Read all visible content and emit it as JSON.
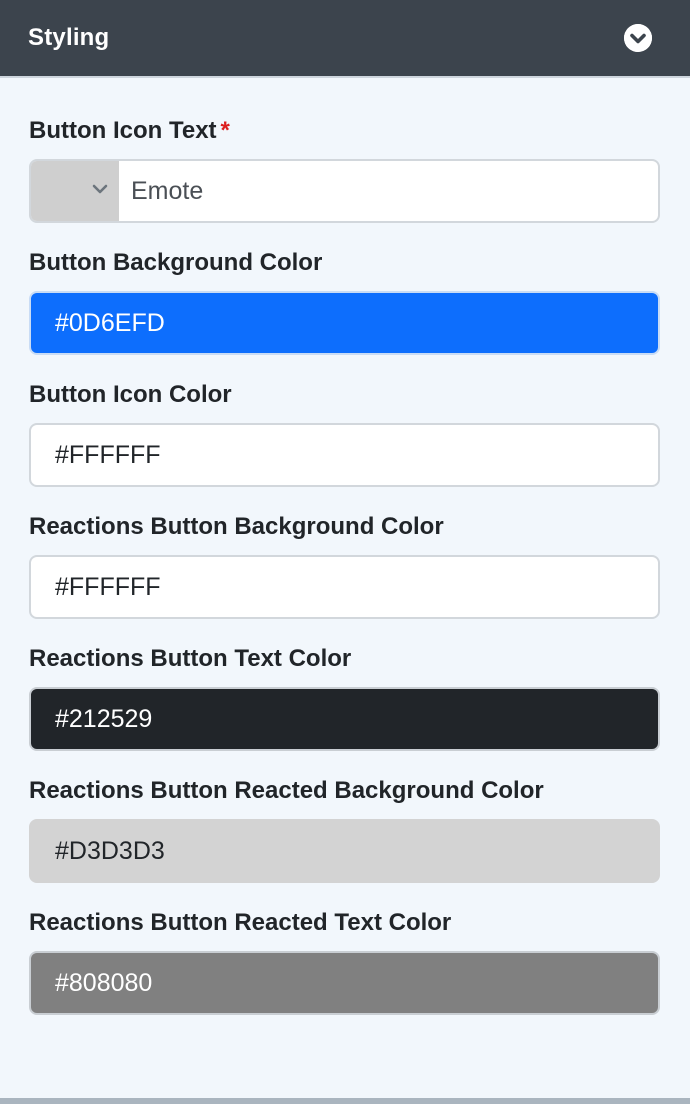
{
  "header": {
    "title": "Styling",
    "toggle_icon": "chevron-down-circle-icon"
  },
  "fields": [
    {
      "label": "Button Icon Text",
      "required": true,
      "required_marker": "*",
      "select_icon": "chevron-down-icon",
      "value": "Emote"
    },
    {
      "label": "Button Background Color",
      "value": "#0D6EFD",
      "background": "#0D6EFD",
      "text_color": "#FFFFFF"
    },
    {
      "label": "Button Icon Color",
      "value": "#FFFFFF",
      "background": "#FFFFFF",
      "text_color": "#212529"
    },
    {
      "label": "Reactions Button Background Color",
      "value": "#FFFFFF",
      "background": "#FFFFFF",
      "text_color": "#212529"
    },
    {
      "label": "Reactions Button Text Color",
      "value": "#212529",
      "background": "#212529",
      "text_color": "#FFFFFF"
    },
    {
      "label": "Reactions Button Reacted Background Color",
      "value": "#D3D3D3",
      "background": "#D3D3D3",
      "text_color": "#212529"
    },
    {
      "label": "Reactions Button Reacted Text Color",
      "value": "#808080",
      "background": "#808080",
      "text_color": "#FFFFFF"
    }
  ]
}
